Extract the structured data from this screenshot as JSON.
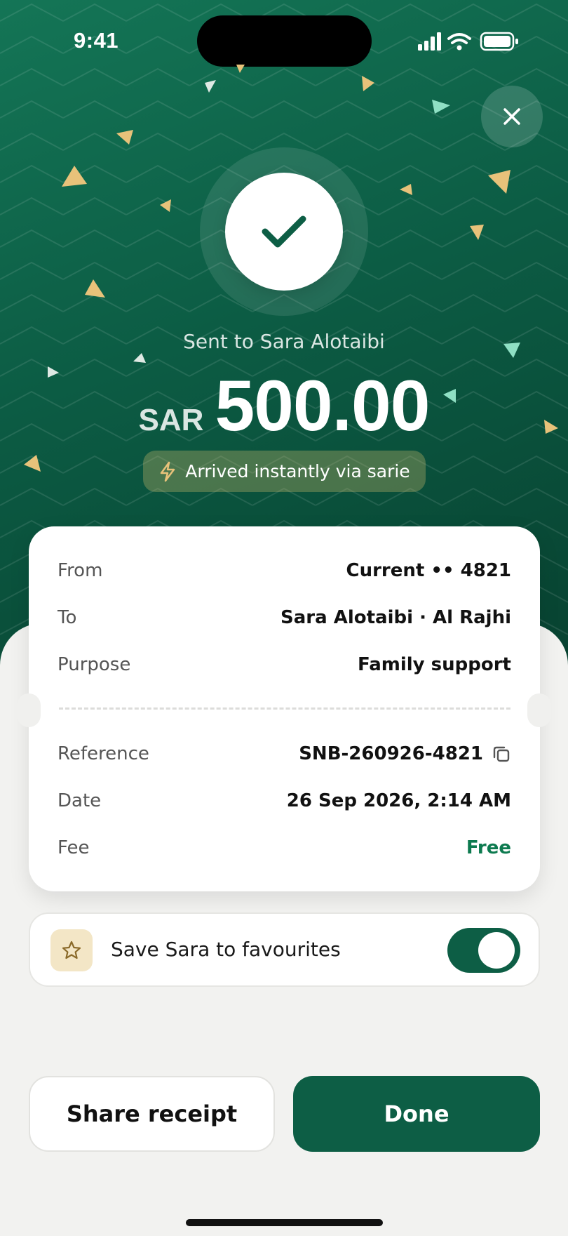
{
  "status_bar": {
    "time": "9:41"
  },
  "header": {
    "sent_to": "Sent to Sara Alotaibi",
    "currency": "SAR",
    "amount": "500.00",
    "instant_note": "Arrived instantly via sarie"
  },
  "details": {
    "rows_top": [
      {
        "label": "From",
        "value": "Current •• 4821"
      },
      {
        "label": "To",
        "value": "Sara Alotaibi · Al Rajhi"
      },
      {
        "label": "Purpose",
        "value": "Family support"
      }
    ],
    "rows_bottom": [
      {
        "label": "Reference",
        "value": "SNB-260926-4821"
      },
      {
        "label": "Date",
        "value": "26 Sep 2026, 2:14 AM"
      },
      {
        "label": "Fee",
        "value": "Free"
      }
    ]
  },
  "favourite": {
    "label": "Save Sara to favourites",
    "enabled": true
  },
  "actions": {
    "share_label": "Share receipt",
    "done_label": "Done"
  },
  "colors": {
    "brand_green": "#0d5e45",
    "hero_gradient_start": "#147556",
    "hero_gradient_end": "#07402f",
    "fee_free": "#0d7a4f",
    "confetti_gold": "#e8c27a",
    "confetti_mint": "#8fe0c4"
  },
  "icons": {
    "close": "close-icon",
    "check": "check-icon",
    "bolt": "lightning-icon",
    "copy": "copy-icon",
    "star": "star-icon"
  }
}
